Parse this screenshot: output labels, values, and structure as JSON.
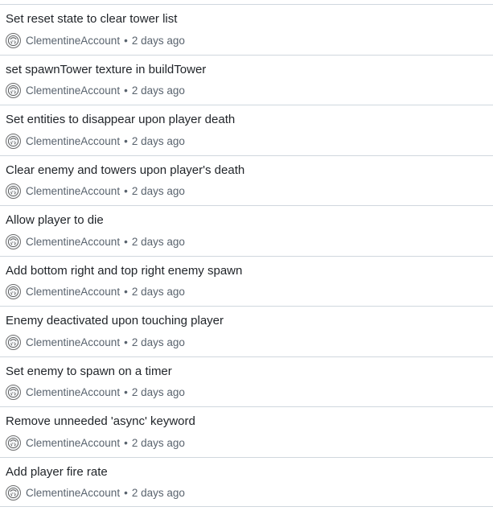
{
  "commits": [
    {
      "title": "Set reset state to clear tower list",
      "author": "ClementineAccount",
      "separator": "•",
      "time": "2 days ago"
    },
    {
      "title": "set spawnTower texture in buildTower",
      "author": "ClementineAccount",
      "separator": "•",
      "time": "2 days ago"
    },
    {
      "title": "Set entities to disappear upon player death",
      "author": "ClementineAccount",
      "separator": "•",
      "time": "2 days ago"
    },
    {
      "title": "Clear enemy and towers upon player's death",
      "author": "ClementineAccount",
      "separator": "•",
      "time": "2 days ago"
    },
    {
      "title": "Allow player to die",
      "author": "ClementineAccount",
      "separator": "•",
      "time": "2 days ago"
    },
    {
      "title": "Add bottom right and top right enemy spawn",
      "author": "ClementineAccount",
      "separator": "•",
      "time": "2 days ago"
    },
    {
      "title": "Enemy deactivated upon touching player",
      "author": "ClementineAccount",
      "separator": "•",
      "time": "2 days ago"
    },
    {
      "title": "Set enemy to spawn on a timer",
      "author": "ClementineAccount",
      "separator": "•",
      "time": "2 days ago"
    },
    {
      "title": "Remove unneeded 'async' keyword",
      "author": "ClementineAccount",
      "separator": "•",
      "time": "2 days ago"
    },
    {
      "title": "Add player fire rate",
      "author": "ClementineAccount",
      "separator": "•",
      "time": "2 days ago"
    }
  ],
  "avatar_icon": "anime-character-avatar-icon"
}
